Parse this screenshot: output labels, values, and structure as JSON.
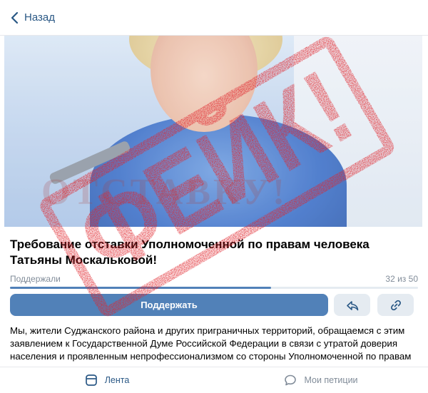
{
  "header": {
    "back_label": "Назад"
  },
  "petition": {
    "title": "Требование отставки Уполномоченной по правам человека Татьяны Москальковой!",
    "supported_label": "Поддержали",
    "count_label": "32 из 50",
    "progress": 0.64,
    "support_button": "Поддержать",
    "body_text": "Мы, жители Суджанского района и других приграничных территорий, обращаемся с этим заявлением к Государственной Думе Российской Федерации в связи с утратой доверия населения и проявленным непрофессионализмом со стороны Уполномоченной по правам"
  },
  "hero": {
    "background_word": "ОТСТАВКУ!"
  },
  "stamp": {
    "text": "ФЕЙК!",
    "color": "#e0232a"
  },
  "tabbar": {
    "tabs": [
      {
        "label": "Лента",
        "icon": "feed-icon",
        "active": true
      },
      {
        "label": "Мои петиции",
        "icon": "speech-bubble-icon",
        "active": false
      }
    ]
  },
  "colors": {
    "accent": "#5181b8",
    "link": "#2a5885",
    "muted": "#818c99"
  }
}
